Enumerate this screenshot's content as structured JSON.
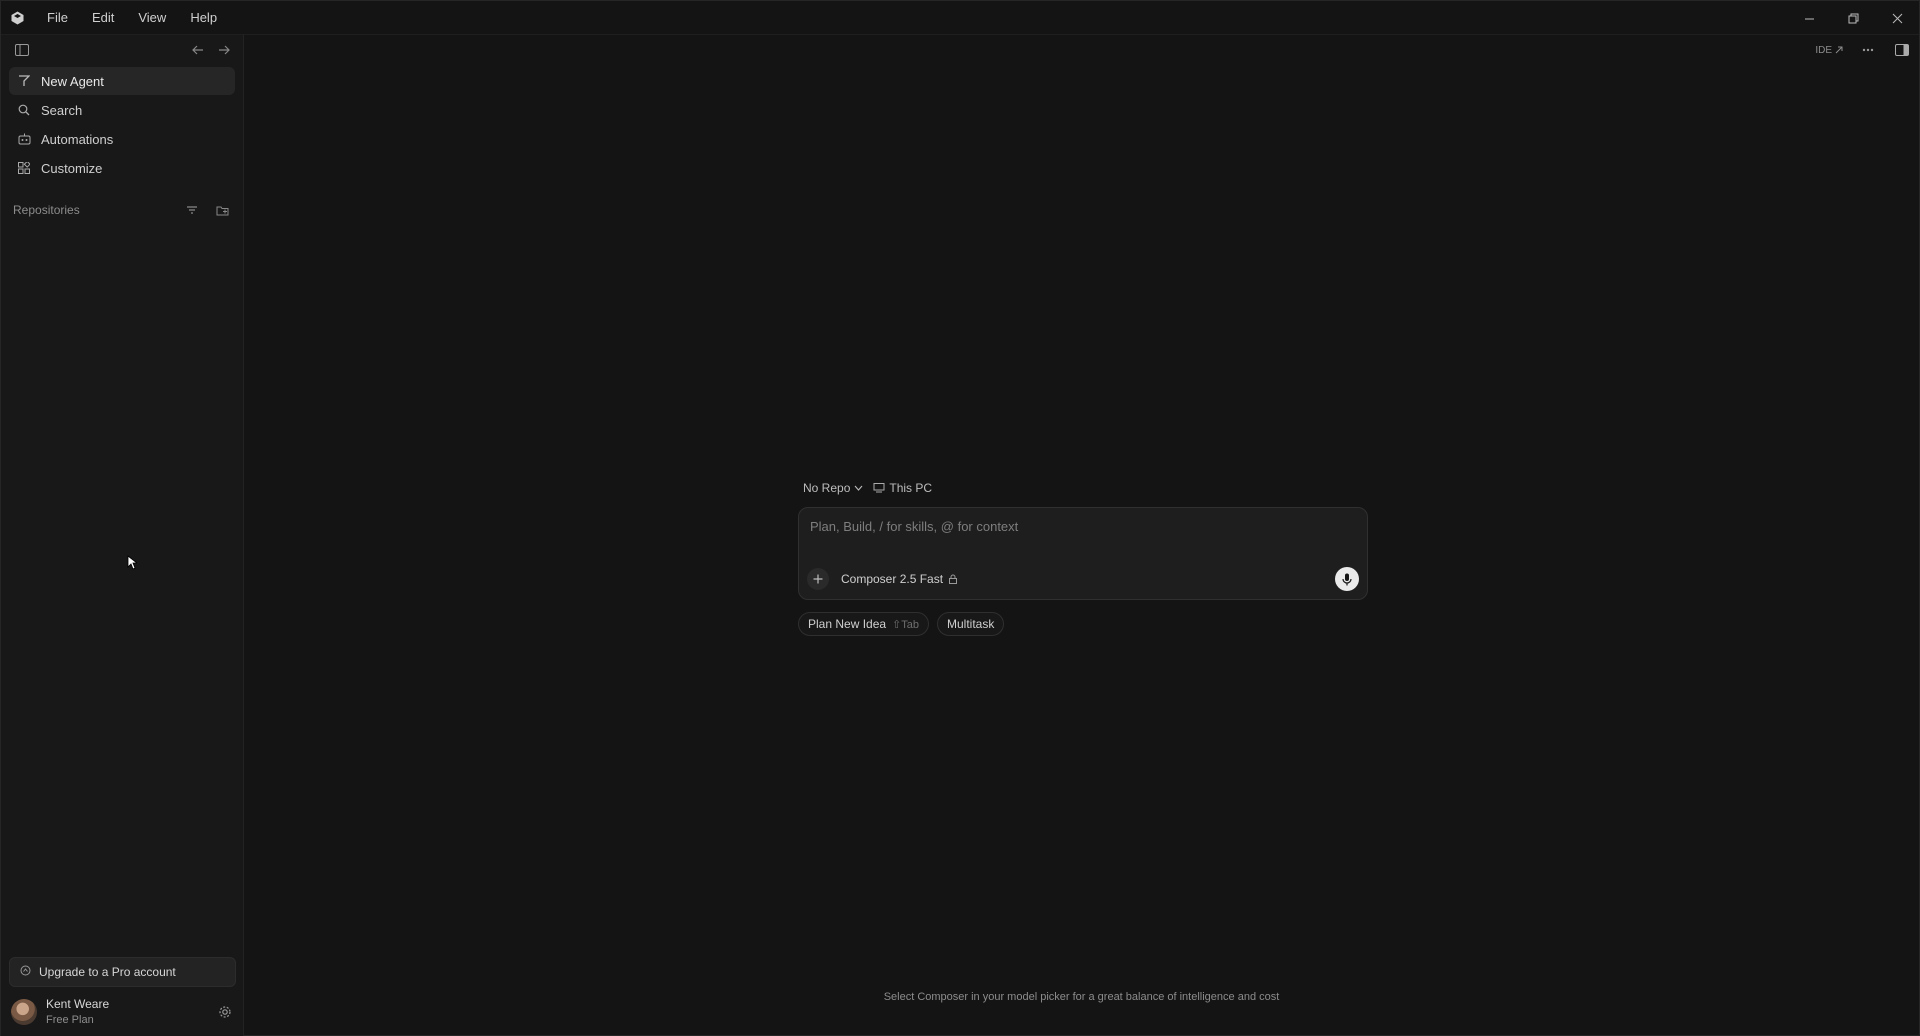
{
  "menu": [
    "File",
    "Edit",
    "View",
    "Help"
  ],
  "sidebar": {
    "items": [
      {
        "label": "New Agent",
        "icon": "agent-icon"
      },
      {
        "label": "Search",
        "icon": "search-icon"
      },
      {
        "label": "Automations",
        "icon": "automations-icon"
      },
      {
        "label": "Customize",
        "icon": "customize-icon"
      }
    ],
    "repositories_label": "Repositories",
    "upgrade_label": "Upgrade to a Pro account",
    "user": {
      "name": "Kent Weare",
      "plan": "Free Plan"
    }
  },
  "main": {
    "ide_label": "IDE",
    "repo_selector": "No Repo",
    "location": "This PC",
    "prompt_placeholder": "Plan, Build, / for skills, @ for context",
    "model": "Composer 2.5 Fast",
    "chips": [
      {
        "label": "Plan New Idea",
        "shortcut": "⇧Tab"
      },
      {
        "label": "Multitask",
        "shortcut": ""
      }
    ],
    "hint": "Select Composer in your model picker for a great balance of intelligence and cost"
  },
  "colors": {
    "background": "#141414",
    "sidebar": "#181818",
    "accent_text": "#d4d4d4"
  }
}
